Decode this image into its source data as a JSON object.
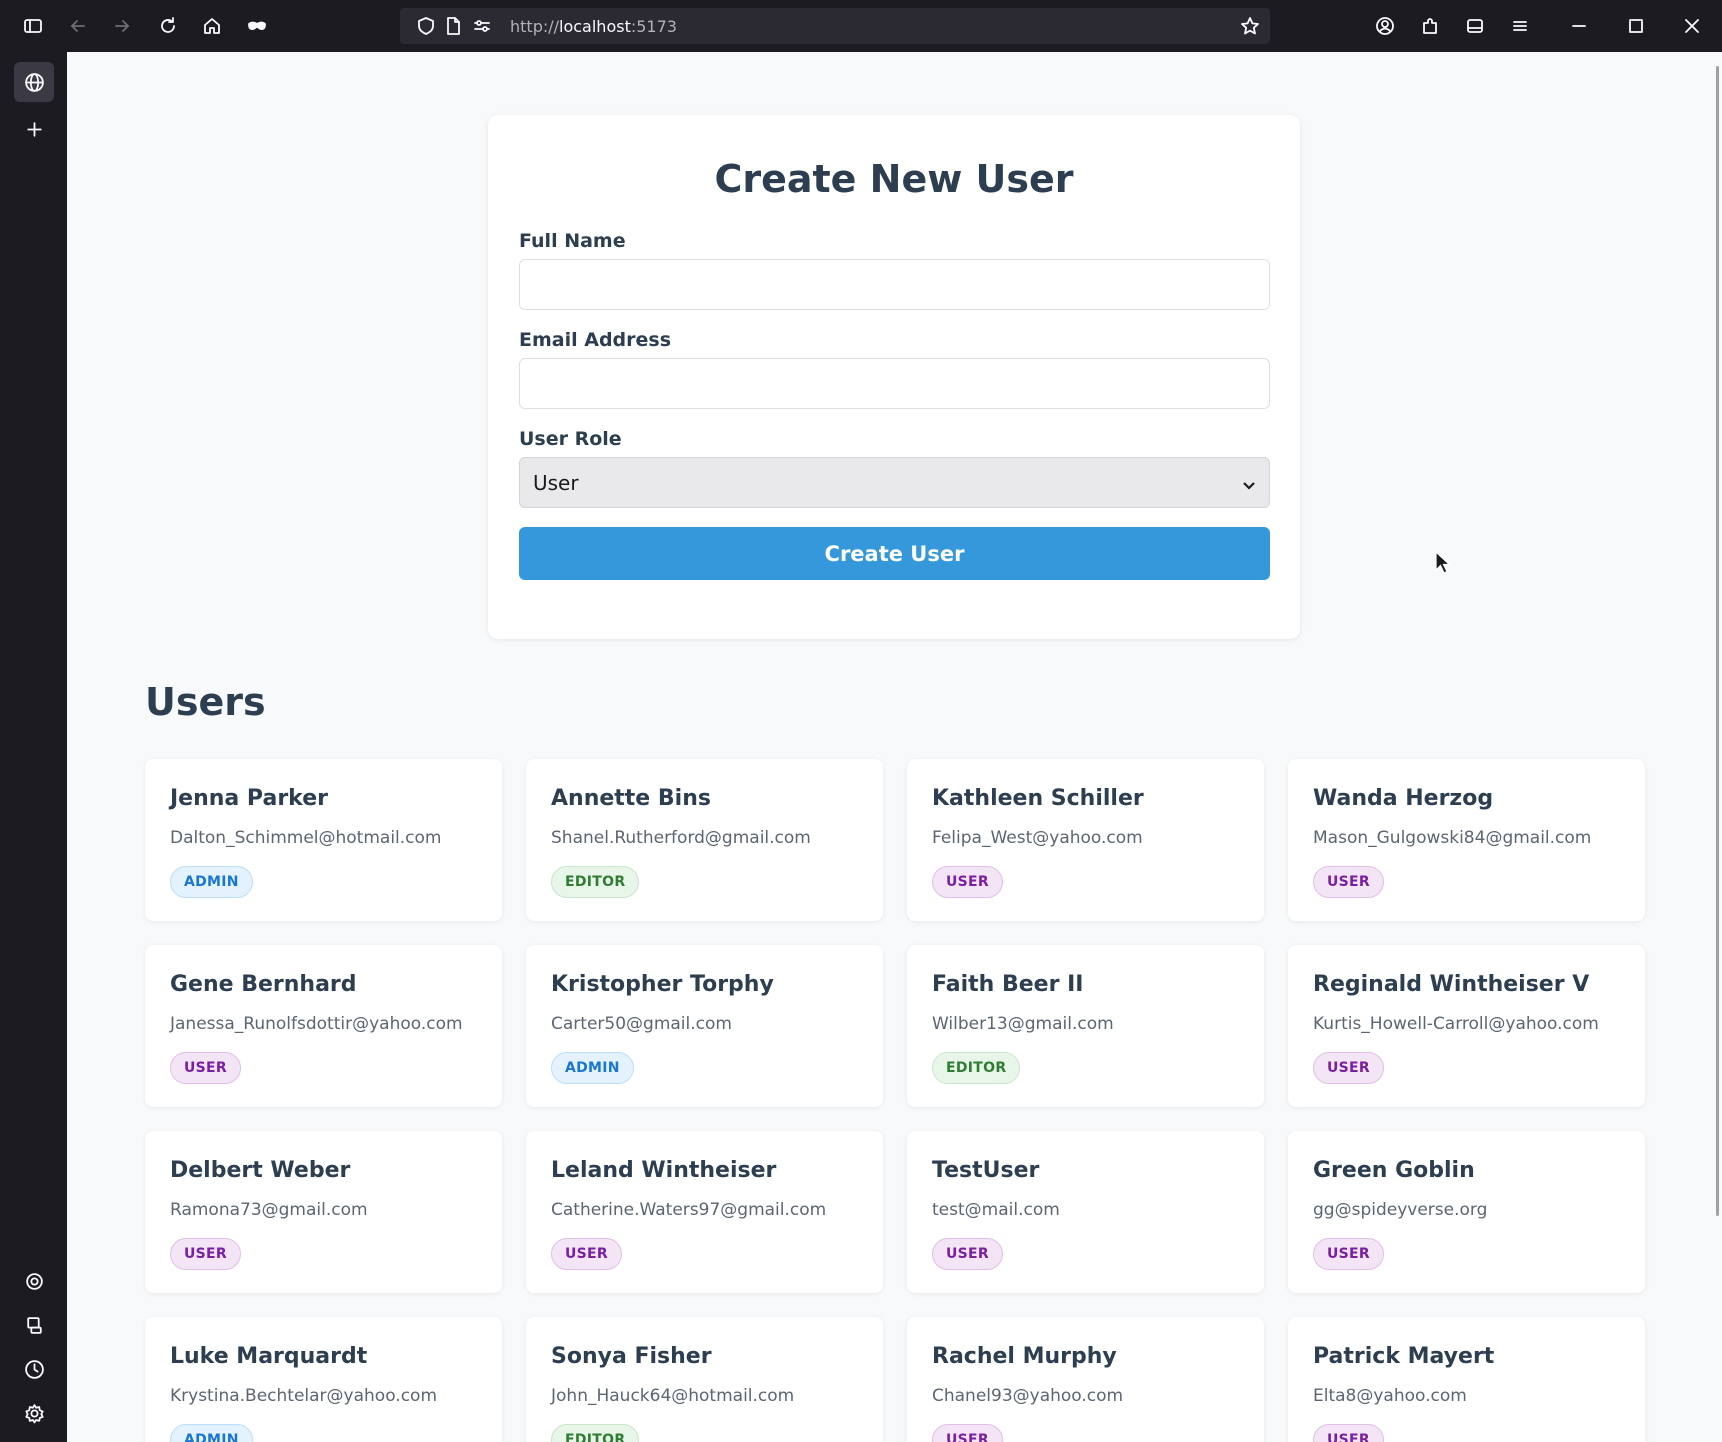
{
  "browser": {
    "url_scheme": "http://",
    "url_host": "localhost",
    "url_port": ":5173"
  },
  "form": {
    "title": "Create New User",
    "name_label": "Full Name",
    "name_value": "",
    "email_label": "Email Address",
    "email_value": "",
    "role_label": "User Role",
    "role_selected": "User",
    "submit_label": "Create User"
  },
  "users_section": {
    "title": "Users",
    "users": [
      {
        "name": "Jenna Parker",
        "email": "Dalton_Schimmel@hotmail.com",
        "role": "ADMIN"
      },
      {
        "name": "Annette Bins",
        "email": "Shanel.Rutherford@gmail.com",
        "role": "EDITOR"
      },
      {
        "name": "Kathleen Schiller",
        "email": "Felipa_West@yahoo.com",
        "role": "USER"
      },
      {
        "name": "Wanda Herzog",
        "email": "Mason_Gulgowski84@gmail.com",
        "role": "USER"
      },
      {
        "name": "Gene Bernhard",
        "email": "Janessa_Runolfsdottir@yahoo.com",
        "role": "USER"
      },
      {
        "name": "Kristopher Torphy",
        "email": "Carter50@gmail.com",
        "role": "ADMIN"
      },
      {
        "name": "Faith Beer II",
        "email": "Wilber13@gmail.com",
        "role": "EDITOR"
      },
      {
        "name": "Reginald Wintheiser V",
        "email": "Kurtis_Howell-Carroll@yahoo.com",
        "role": "USER"
      },
      {
        "name": "Delbert Weber",
        "email": "Ramona73@gmail.com",
        "role": "USER"
      },
      {
        "name": "Leland Wintheiser",
        "email": "Catherine.Waters97@gmail.com",
        "role": "USER"
      },
      {
        "name": "TestUser",
        "email": "test@mail.com",
        "role": "USER"
      },
      {
        "name": "Green Goblin",
        "email": "gg@spideyverse.org",
        "role": "USER"
      },
      {
        "name": "Luke Marquardt",
        "email": "Krystina.Bechtelar@yahoo.com",
        "role": "ADMIN"
      },
      {
        "name": "Sonya Fisher",
        "email": "John_Hauck64@hotmail.com",
        "role": "EDITOR"
      },
      {
        "name": "Rachel Murphy",
        "email": "Chanel93@yahoo.com",
        "role": "USER"
      },
      {
        "name": "Patrick Mayert",
        "email": "Elta8@yahoo.com",
        "role": "USER"
      }
    ]
  },
  "colors": {
    "primary": "#3498db",
    "heading": "#2c3e50",
    "admin": "#1976d2",
    "editor": "#2e7d32",
    "user": "#7b1fa2"
  },
  "icons": [
    "sidebar-toggle-icon",
    "back-icon",
    "forward-icon",
    "reload-icon",
    "home-icon",
    "private-mask-icon",
    "shield-icon",
    "page-icon",
    "permissions-icon",
    "star-icon",
    "account-icon",
    "extensions-icon",
    "tabs-icon",
    "menu-icon",
    "minimize-icon",
    "maximize-icon",
    "close-icon",
    "globe-icon",
    "plus-icon",
    "ai-chat-icon",
    "synced-tabs-icon",
    "history-icon",
    "settings-icon"
  ]
}
